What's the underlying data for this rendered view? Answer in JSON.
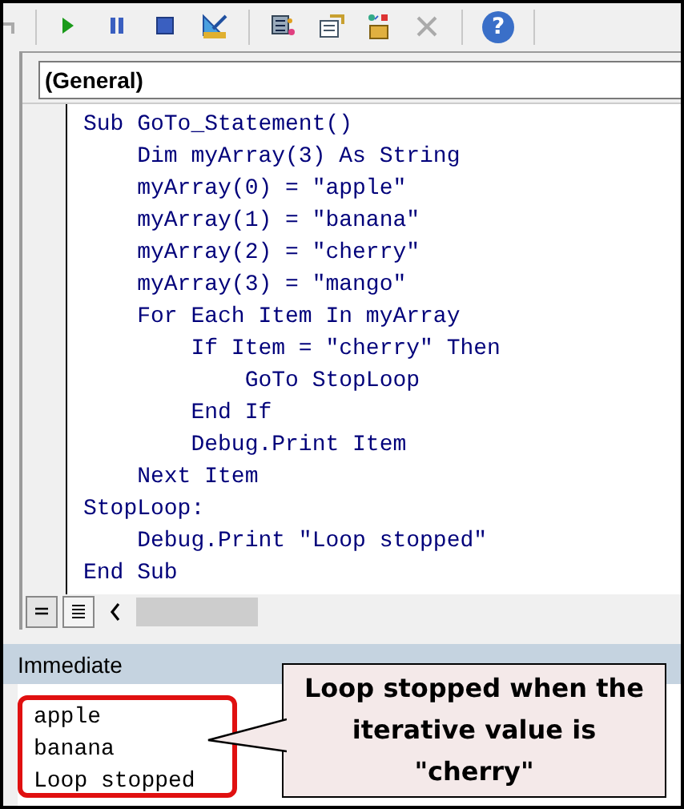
{
  "toolbar": {
    "help_label": "?"
  },
  "object_dropdown": {
    "value": "(General)"
  },
  "code_lines": [
    "Sub GoTo_Statement()",
    "    Dim myArray(3) As String",
    "    myArray(0) = \"apple\"",
    "    myArray(1) = \"banana\"",
    "    myArray(2) = \"cherry\"",
    "    myArray(3) = \"mango\"",
    "    For Each Item In myArray",
    "        If Item = \"cherry\" Then",
    "            GoTo StopLoop",
    "        End If",
    "        Debug.Print Item",
    "    Next Item",
    "StopLoop:",
    "    Debug.Print \"Loop stopped\"",
    "End Sub"
  ],
  "immediate": {
    "title": "Immediate",
    "lines": [
      "apple",
      "banana",
      "Loop stopped"
    ]
  },
  "callout": {
    "text": "Loop stopped when the iterative value is \"cherry\""
  }
}
